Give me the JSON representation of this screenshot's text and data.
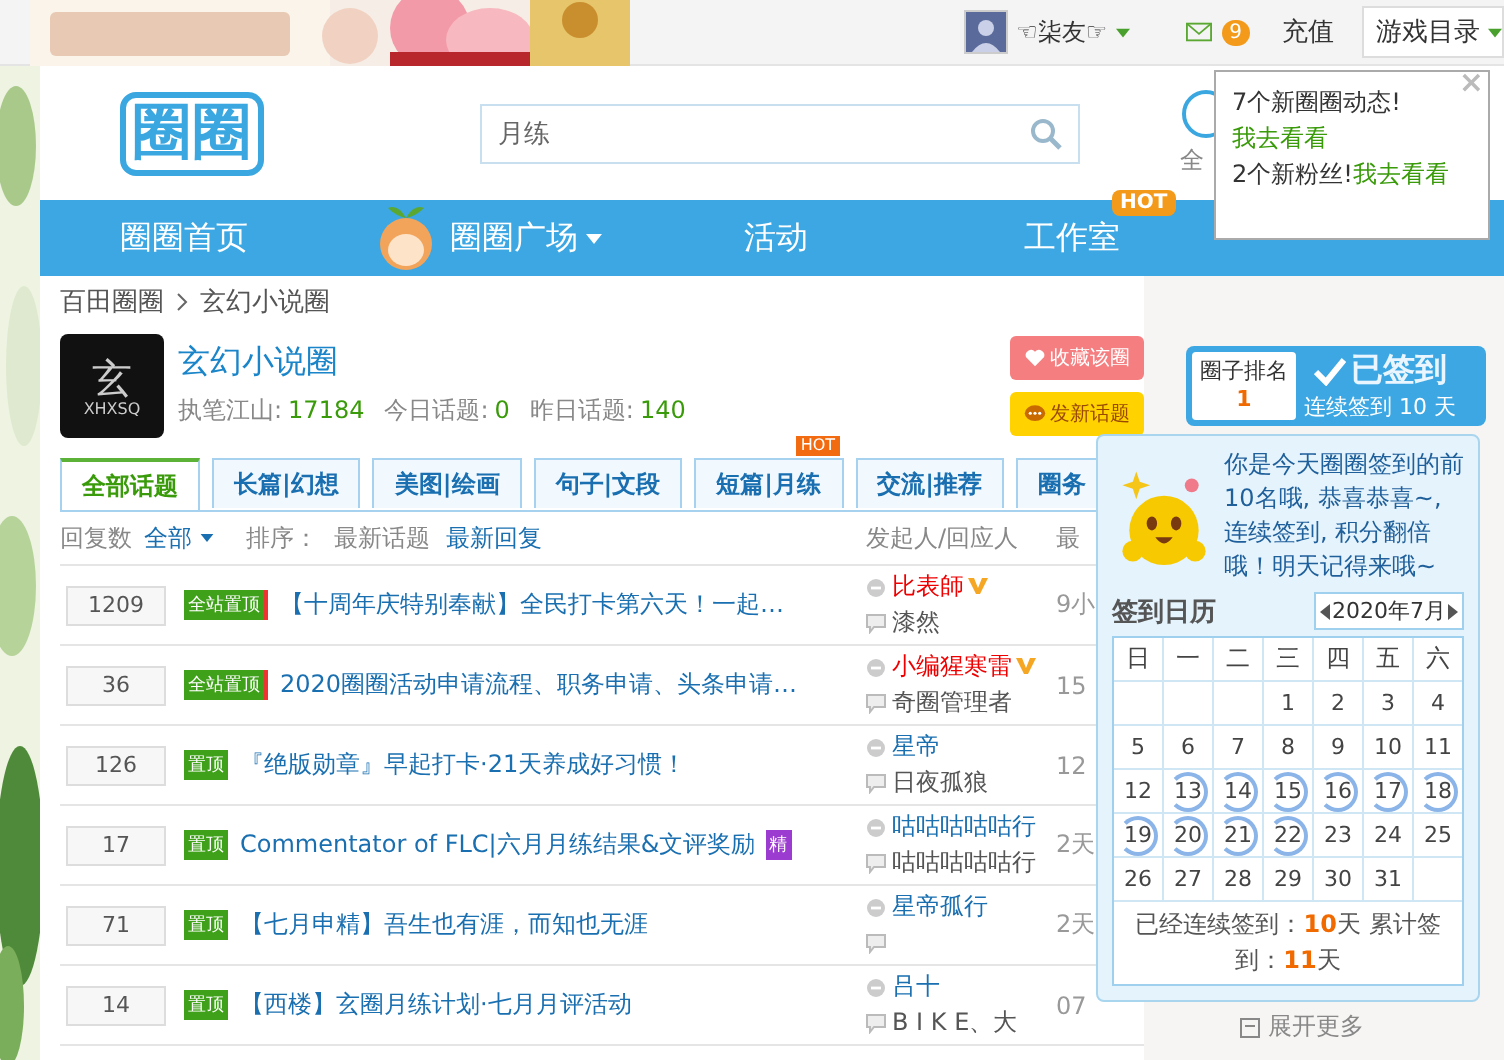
{
  "top_bar": {
    "user": "☜柒友☞",
    "mail_count": "9",
    "recharge": "充值",
    "game_menu": "游戏目录"
  },
  "header": {
    "logo": "圈圈",
    "search": {
      "value": "月练"
    },
    "shortcut": "全"
  },
  "nav": [
    {
      "label": "圈圈首页",
      "kind": "plain"
    },
    {
      "label": "圈圈广场",
      "kind": "mascot"
    },
    {
      "label": "活动",
      "kind": "plain"
    },
    {
      "label": "工作室",
      "kind": "hot",
      "badge": "HOT"
    }
  ],
  "notice": {
    "close": "×",
    "lines": [
      {
        "text": "7个新圈圈动态!",
        "link": "我去看看"
      },
      {
        "text": "2个新粉丝!",
        "link": "我去看看"
      }
    ]
  },
  "breadcrumb": [
    "百田圈圈",
    "玄幻小说圈"
  ],
  "circle": {
    "logo_char": "玄",
    "logo_code": "XHXSQ",
    "name": "玄幻小说圈",
    "stats": [
      {
        "label": "执笔江山:",
        "value": "17184"
      },
      {
        "label": "今日话题:",
        "value": "0"
      },
      {
        "label": "昨日话题:",
        "value": "140"
      }
    ],
    "actions": [
      {
        "label": "收藏该圈",
        "kind": "favorite"
      },
      {
        "label": "发新话题",
        "kind": "post"
      }
    ]
  },
  "signin": {
    "rank_label": "圈子排名",
    "rank": "1",
    "status": "已签到",
    "streak": "连续签到 10 天"
  },
  "tabs": [
    {
      "label": "全部话题",
      "selected": true
    },
    {
      "label": "长篇|幻想",
      "selected": false
    },
    {
      "label": "美图|绘画",
      "selected": false
    },
    {
      "label": "句子|文段",
      "selected": false
    },
    {
      "label": "短篇|月练",
      "selected": false,
      "badge": "HOT"
    },
    {
      "label": "交流|推荐",
      "selected": false
    },
    {
      "label": "圈务",
      "selected": false
    }
  ],
  "list_header": {
    "reply_label": "回复数",
    "filter": "全部",
    "sort_label": "排序：",
    "author_col": "发起人/回应人",
    "last_col": "最",
    "sorts": [
      {
        "label": "最新话题",
        "selected": false
      },
      {
        "label": "最新回复",
        "selected": true
      }
    ]
  },
  "rows": [
    {
      "count": "1209",
      "tag": {
        "label": "全站置顶",
        "kind": "site"
      },
      "title": "【十周年庆特别奉献】全民打卡第六天！一起…",
      "author": "比表師",
      "author_highlight": true,
      "author_vip": true,
      "replier": "漆然",
      "time": "9小"
    },
    {
      "count": "36",
      "tag": {
        "label": "全站置顶",
        "kind": "site"
      },
      "title": "2020圈圈活动申请流程、职务申请、头条申请…",
      "author": "小编猩寒雷",
      "author_highlight": true,
      "author_vip": true,
      "replier": "奇圈管理者",
      "time": "15"
    },
    {
      "count": "126",
      "tag": {
        "label": "置顶",
        "kind": "top"
      },
      "title": "『绝版勋章』早起打卡·21天养成好习惯！",
      "author": "星帝",
      "author_highlight": false,
      "author_vip": false,
      "replier": "日夜孤狼",
      "time": "12"
    },
    {
      "count": "17",
      "tag": {
        "label": "置顶",
        "kind": "top"
      },
      "title": "Commentator of FLC|六月月练结果&文评奖励",
      "essence": "精",
      "author": "咕咕咕咕咕行",
      "author_highlight": false,
      "author_vip": false,
      "replier": "咕咕咕咕咕行",
      "time": "2天"
    },
    {
      "count": "71",
      "tag": {
        "label": "置顶",
        "kind": "top"
      },
      "title": "【七月申精】吾生也有涯，而知也无涯",
      "author": "星帝孤行",
      "author_highlight": false,
      "author_vip": false,
      "time": "2天"
    },
    {
      "count": "14",
      "tag": {
        "label": "置顶",
        "kind": "top"
      },
      "title": "【西楼】玄圈月练计划·七月月评活动",
      "author": "吕十",
      "author_highlight": false,
      "author_vip": false,
      "replier": "B I K E、大",
      "time": "07"
    }
  ],
  "popover": {
    "message": "你是今天圈圈签到的前10名哦, 恭喜恭喜~, 连续签到, 积分翻倍哦！明天记得来哦~"
  },
  "calendar": {
    "title": "签到日历",
    "month": "2020年7月",
    "weekdays": [
      "日",
      "一",
      "二",
      "三",
      "四",
      "五",
      "六"
    ],
    "weeks": [
      [
        {
          "kind": "blank"
        },
        {
          "kind": "blank"
        },
        {
          "kind": "blank"
        },
        {
          "kind": "day",
          "day": "1",
          "signed": false
        },
        {
          "kind": "day",
          "day": "2",
          "signed": false
        },
        {
          "kind": "day",
          "day": "3",
          "signed": false
        },
        {
          "kind": "day",
          "day": "4",
          "signed": false
        }
      ],
      [
        {
          "kind": "day",
          "day": "5",
          "signed": false
        },
        {
          "kind": "day",
          "day": "6",
          "signed": false
        },
        {
          "kind": "day",
          "day": "7",
          "signed": false
        },
        {
          "kind": "day",
          "day": "8",
          "signed": false
        },
        {
          "kind": "day",
          "day": "9",
          "signed": false
        },
        {
          "kind": "day",
          "day": "10",
          "signed": false
        },
        {
          "kind": "day",
          "day": "11",
          "signed": false
        }
      ],
      [
        {
          "kind": "day",
          "day": "12",
          "signed": false
        },
        {
          "kind": "day",
          "day": "13",
          "signed": true
        },
        {
          "kind": "day",
          "day": "14",
          "signed": true
        },
        {
          "kind": "day",
          "day": "15",
          "signed": true
        },
        {
          "kind": "day",
          "day": "16",
          "signed": true
        },
        {
          "kind": "day",
          "day": "17",
          "signed": true
        },
        {
          "kind": "day",
          "day": "18",
          "signed": true
        }
      ],
      [
        {
          "kind": "day",
          "day": "19",
          "signed": true
        },
        {
          "kind": "day",
          "day": "20",
          "signed": true
        },
        {
          "kind": "day",
          "day": "21",
          "signed": true
        },
        {
          "kind": "day",
          "day": "22",
          "signed": true
        },
        {
          "kind": "day",
          "day": "23",
          "signed": false
        },
        {
          "kind": "day",
          "day": "24",
          "signed": false
        },
        {
          "kind": "day",
          "day": "25",
          "signed": false
        }
      ],
      [
        {
          "kind": "day",
          "day": "26",
          "signed": false
        },
        {
          "kind": "day",
          "day": "27",
          "signed": false
        },
        {
          "kind": "day",
          "day": "28",
          "signed": false
        },
        {
          "kind": "day",
          "day": "29",
          "signed": false
        },
        {
          "kind": "day",
          "day": "30",
          "signed": false
        },
        {
          "kind": "day",
          "day": "31",
          "signed": false
        },
        {
          "kind": "blank"
        }
      ]
    ],
    "summary": "已经连续签到：**10**天 累计签到：**11**天"
  },
  "more": "展开更多"
}
